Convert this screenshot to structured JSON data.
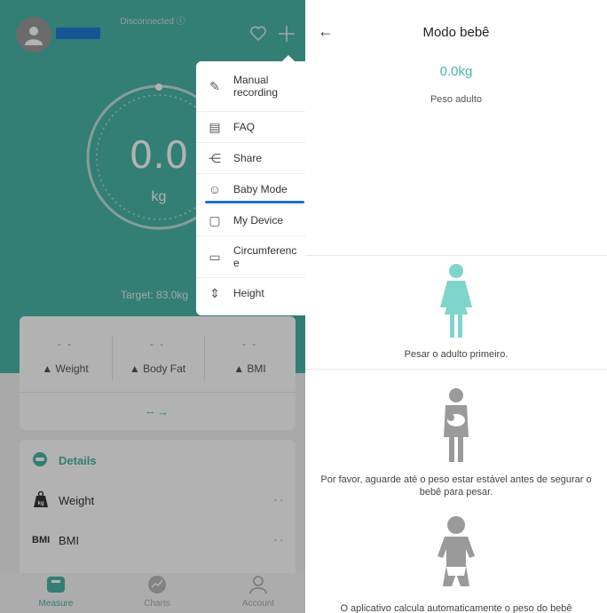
{
  "left": {
    "connection_status": "Disconnected ⓘ",
    "weight_value": "0.0",
    "weight_unit": "kg",
    "target": "Target: 83.0kg",
    "metrics": [
      {
        "value": "- -",
        "label": "▲ Weight"
      },
      {
        "value": "- -",
        "label": "▲ Body Fat"
      },
      {
        "value": "- -",
        "label": "▲ BMI"
      }
    ],
    "arrow_row": "-- →",
    "details": {
      "title": "Details",
      "rows": [
        {
          "icon_text": "kg",
          "label": "Weight",
          "value": "- -"
        },
        {
          "icon_text": "BMI",
          "label": "BMI",
          "value": "- -"
        }
      ]
    },
    "tabs": [
      "Measure",
      "Charts",
      "Account"
    ],
    "colors": {
      "teal": "#4ab5a8",
      "highlight": "#1f6fcf"
    }
  },
  "menu": {
    "items": [
      {
        "icon": "edit-icon",
        "label": "Manual recording"
      },
      {
        "icon": "book-icon",
        "label": "FAQ"
      },
      {
        "icon": "share-icon",
        "label": "Share"
      },
      {
        "icon": "baby-icon",
        "label": "Baby Mode"
      },
      {
        "icon": "device-icon",
        "label": "My Device"
      },
      {
        "icon": "ruler-icon",
        "label": "Circumference"
      },
      {
        "icon": "height-icon",
        "label": "Height"
      }
    ]
  },
  "right": {
    "title": "Modo bebê",
    "weight": "0.0kg",
    "weight_label": "Peso adulto",
    "step1": "Pesar o adulto primeiro.",
    "step2": "Por favor, aguarde até o peso estar estável antes de segurar o bebê para pesar.",
    "step3": "O aplicativo calcula automaticamente o peso do bebê"
  }
}
